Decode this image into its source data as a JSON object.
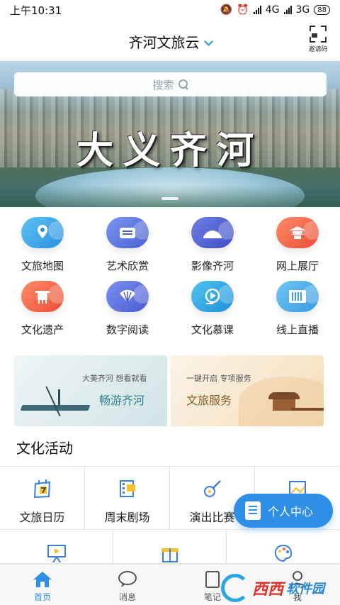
{
  "status_bar": {
    "time": "上午10:31",
    "net1": "4G",
    "net2": "3G",
    "battery": "88"
  },
  "header": {
    "title": "齐河文旅云",
    "invite_label": "邀请码"
  },
  "banner": {
    "search_placeholder": "搜索",
    "slogan": "大义齐河"
  },
  "grid": [
    {
      "label": "文旅地图",
      "icon": "map-pin-icon",
      "color": "#3aa5e8"
    },
    {
      "label": "艺术欣赏",
      "icon": "art-icon",
      "color": "#4a6fd8"
    },
    {
      "label": "影像齐河",
      "icon": "mountain-icon",
      "color": "#4e5fcf"
    },
    {
      "label": "网上展厅",
      "icon": "pavilion-icon",
      "color": "#f06a4a"
    },
    {
      "label": "文化遗产",
      "icon": "bronze-vessel-icon",
      "color": "#f0684a"
    },
    {
      "label": "数字阅读",
      "icon": "fan-icon",
      "color": "#5a6ed8"
    },
    {
      "label": "文化慕课",
      "icon": "video-course-icon",
      "color": "#2fa8e0"
    },
    {
      "label": "线上直播",
      "icon": "live-icon",
      "color": "#4aa8e8"
    }
  ],
  "promo_left": {
    "small": "大美齐河 想看就看",
    "big": "畅游齐河"
  },
  "promo_right": {
    "small": "一键开启 专项服务",
    "big": "文旅服务"
  },
  "section_title": "文化活动",
  "activities_row1": [
    {
      "label": "文旅日历",
      "icon": "calendar-icon"
    },
    {
      "label": "周末剧场",
      "icon": "film-icon"
    },
    {
      "label": "演出比赛",
      "icon": "guitar-icon"
    },
    {
      "label": "",
      "icon": "picture-icon"
    }
  ],
  "activities_row2": [
    {
      "icon": "presentation-icon"
    },
    {
      "icon": "gift-icon"
    },
    {
      "icon": "palette-icon"
    }
  ],
  "fab": {
    "label": "个人中心"
  },
  "tabbar": [
    {
      "label": "首页",
      "icon": "home-icon",
      "active": true
    },
    {
      "label": "消息",
      "icon": "message-icon",
      "active": false
    },
    {
      "label": "笔记",
      "icon": "note-icon",
      "active": false
    },
    {
      "label": "我",
      "icon": "user-icon",
      "active": false
    }
  ],
  "watermark": {
    "brand": "西西",
    "sub": "软件园"
  },
  "colors": {
    "accent": "#2f8fe6",
    "text": "#222222"
  }
}
